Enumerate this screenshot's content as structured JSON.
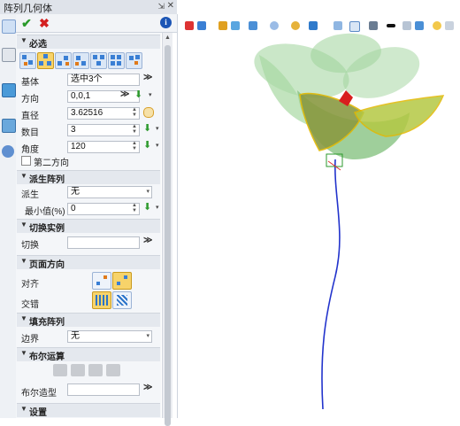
{
  "panel": {
    "title": "阵列几何体",
    "pin_glyph": "⇲",
    "close_glyph": "✕",
    "ok_glyph": "✔",
    "cancel_glyph": "✖",
    "info_glyph": "i"
  },
  "required": {
    "header": "必选",
    "base_label": "基体",
    "base_value": "选中3个",
    "direction_label": "方向",
    "direction_value": "0,0,1",
    "diameter_label": "直径",
    "diameter_value": "3.62516",
    "count_label": "数目",
    "count_value": "3",
    "angle_label": "角度",
    "angle_value": "120",
    "second_dir_label": "第二方向"
  },
  "derived": {
    "header": "派生阵列",
    "derive_label": "派生",
    "derive_value": "无",
    "min_label": "最小值(%)",
    "min_value": "0"
  },
  "switch_instance": {
    "header": "切换实例",
    "switch_label": "切换",
    "switch_value": ""
  },
  "face_direction": {
    "header": "页面方向",
    "align_label": "对齐",
    "stagger_label": "交错"
  },
  "fill_array": {
    "header": "填充阵列",
    "boundary_label": "边界",
    "boundary_value": "无"
  },
  "boolean": {
    "header": "布尔运算",
    "mold_label": "布尔造型",
    "mold_value": ""
  },
  "settings": {
    "header": "设置"
  },
  "glyphs": {
    "collapse": "▼",
    "dropdown": "▾",
    "spin": "▲\n▼",
    "chevron": "≫",
    "green_arrow": "⬇"
  },
  "colors": {
    "accent": "#f7d36a",
    "flower_green": "#8cc68a",
    "stem_blue": "#2233cc",
    "center_red": "#d81e1e",
    "outline_yellow": "#e2b800"
  }
}
